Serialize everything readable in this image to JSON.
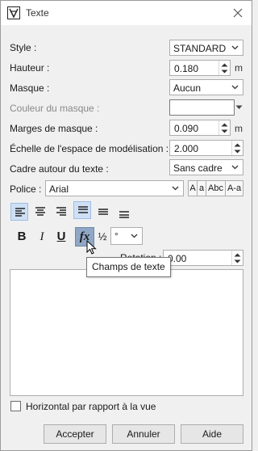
{
  "window": {
    "title": "Texte"
  },
  "style": {
    "label": "Style :",
    "value": "STANDARD"
  },
  "hauteur": {
    "label": "Hauteur :",
    "value": "0.180",
    "unit": "m"
  },
  "masque": {
    "label": "Masque :",
    "value": "Aucun"
  },
  "couleur_masque": {
    "label": "Couleur du masque :",
    "value": ""
  },
  "marges_masque": {
    "label": "Marges de masque :",
    "value": "0.090",
    "unit": "m"
  },
  "echelle": {
    "label": "Échelle de l'espace de modélisation :",
    "value": "2.000"
  },
  "cadre": {
    "label": "Cadre autour du texte :",
    "value": "Sans cadre"
  },
  "police": {
    "label": "Police :",
    "value": "Arial",
    "case_buttons": [
      "A",
      "a",
      "Abc",
      "A-a"
    ]
  },
  "toolbar": {
    "bold": "B",
    "italic": "I",
    "underline": "U",
    "fx": "fx",
    "fraction": "½",
    "symbol_value": "°"
  },
  "rotation": {
    "label": "Rotation :",
    "value": "0.00"
  },
  "tooltip": {
    "text": "Champs de texte"
  },
  "horizontal_checkbox": {
    "label": "Horizontal par rapport à la vue",
    "checked": false
  },
  "buttons": {
    "accept": "Accepter",
    "cancel": "Annuler",
    "help": "Aide"
  },
  "colors": {
    "active_button_bg": "#cfe0f5",
    "window_bg": "#f0f0f0"
  }
}
